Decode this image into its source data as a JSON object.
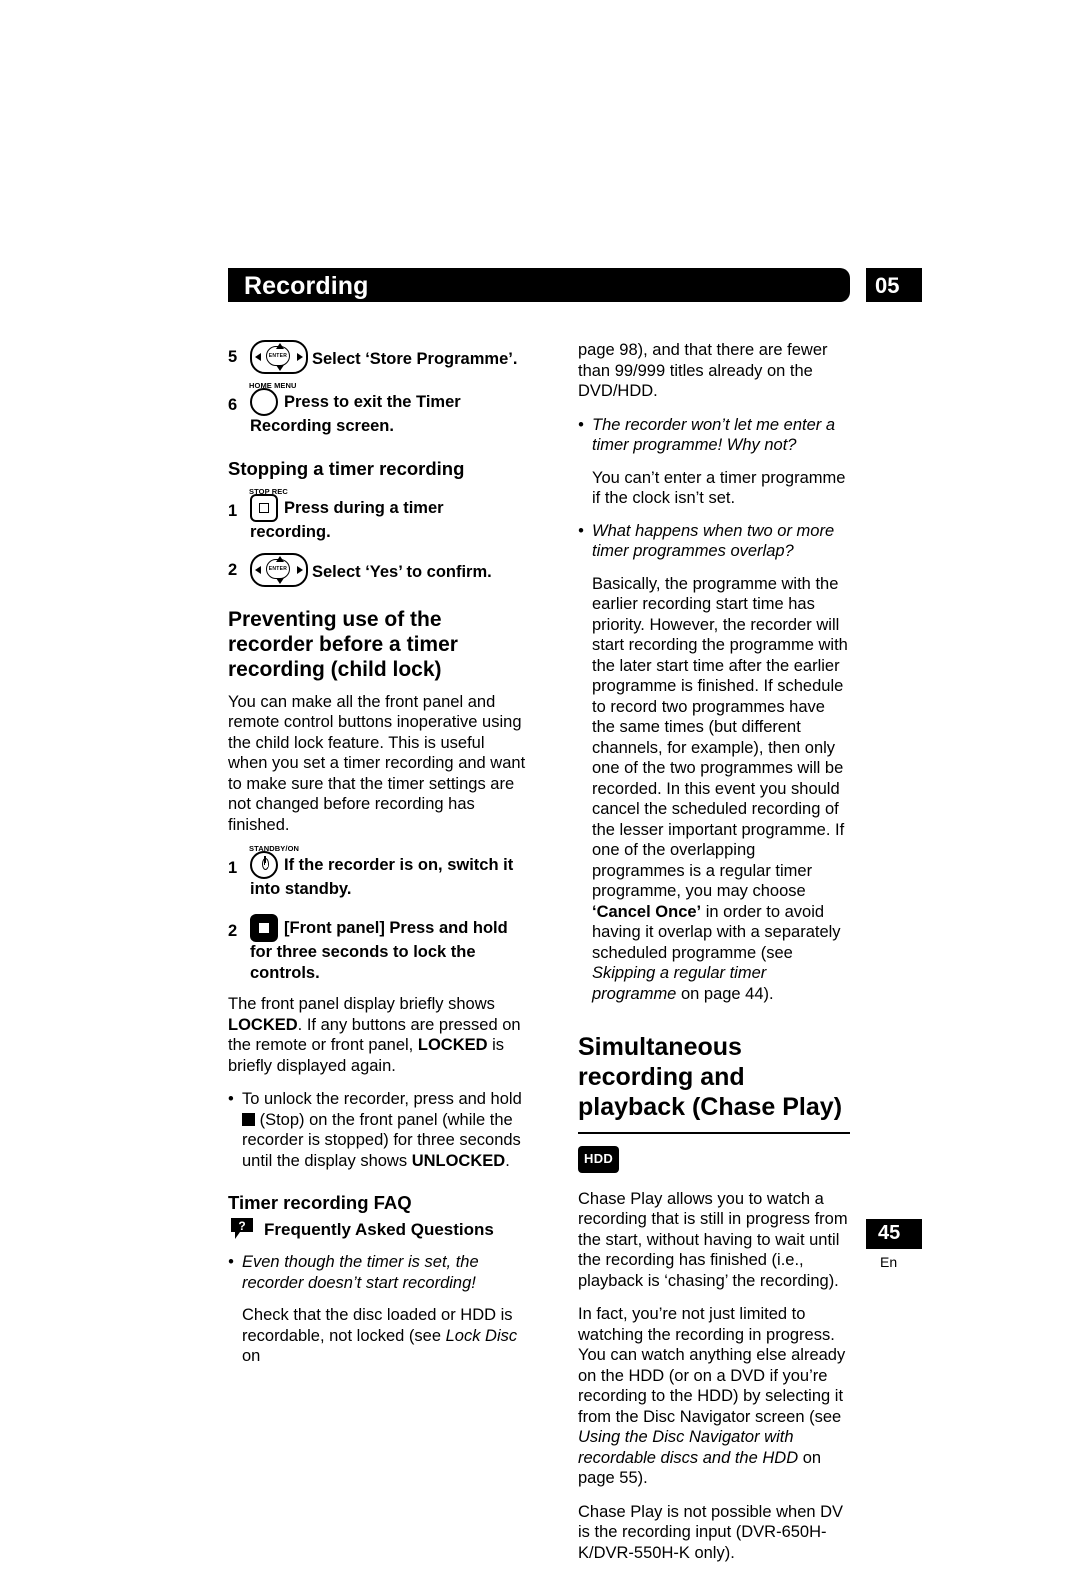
{
  "header": {
    "title": "Recording",
    "chapter": "05"
  },
  "footer": {
    "page_number": "45",
    "language": "En"
  },
  "left_column": {
    "step5": {
      "num": "5",
      "icon_label": "ENTER",
      "text": "Select ‘Store Programme’."
    },
    "step6": {
      "num": "6",
      "icon_label": "HOME MENU",
      "text": "Press to exit the Timer Recording screen."
    },
    "heading_stopping": "Stopping a timer recording",
    "stop_step1": {
      "num": "1",
      "icon_label": "STOP REC",
      "text": "Press during a timer recording."
    },
    "stop_step2": {
      "num": "2",
      "icon_label": "ENTER",
      "text": "Select ‘Yes’ to confirm."
    },
    "heading_preventing": "Preventing use of the recorder before a timer recording (child lock)",
    "para_childlock": "You can make all the front panel and remote control buttons inoperative using the child lock feature. This is useful when you set a timer recording and want to make sure that the timer settings are not changed before recording has finished.",
    "lock_step1": {
      "num": "1",
      "icon_label": "STANDBY/ON",
      "text": "If the recorder is on, switch it into standby."
    },
    "lock_step2": {
      "num": "2",
      "text_bold_1": "[Front panel] Press and hold for three seconds to lock the controls."
    },
    "para_locked_1": "The front panel display briefly shows ",
    "locked_word": "LOCKED",
    "para_locked_2": ". If any buttons are pressed on the remote or front panel, ",
    "locked_word_2": "LOCKED",
    "para_locked_3": " is briefly displayed again.",
    "bullet_unlock_1": "To unlock the recorder, press and hold ",
    "bullet_unlock_2": " (Stop) on the front panel (while the recorder is stopped) for three seconds until the display shows ",
    "unlocked_word": "UNLOCKED",
    "bullet_unlock_3": ".",
    "heading_faq": "Timer recording FAQ",
    "faq_title": "Frequently Asked Questions",
    "faq_q1": "Even though the timer is set, the recorder doesn’t start recording!",
    "faq_a1_1": "Check that the disc loaded or HDD is recordable, not locked (see ",
    "faq_a1_italic": "Lock Disc",
    "faq_a1_2": " on"
  },
  "right_column": {
    "cont_1": "page 98), and that there are fewer than 99/999 titles already on the DVD/HDD.",
    "q2": "The recorder won’t let me enter a timer programme! Why not?",
    "a2": "You can’t enter a timer programme if the clock isn’t set.",
    "q3": "What happens when two or more timer programmes overlap?",
    "a3_part1": "Basically, the programme with the earlier recording start time has priority. However, the recorder will start recording the programme with the later start time after the earlier programme is finished. If schedule to record two programmes have the same times (but different channels, for example), then only one of the two programmes will be recorded. In this event you should cancel the scheduled recording of the lesser important programme. If one of the overlapping programmes is a regular timer programme, you may choose ",
    "cancel_once": "‘Cancel Once’",
    "a3_part2": " in order to avoid having it overlap with a separately scheduled programme (see ",
    "a3_italic": "Skipping a regular timer programme",
    "a3_part3": " on page 44).",
    "heading_chase": "Simultaneous recording and playback (Chase Play)",
    "hdd_badge": "HDD",
    "chase_p1": "Chase Play allows you to watch a recording that is still in progress from the start, without having to wait until the recording has finished (i.e., playback is ‘chasing’ the recording).",
    "chase_p2_1": "In fact, you’re not just limited to watching the recording in progress. You can watch anything else already on the HDD (or on a DVD if you’re recording to the HDD) by selecting it from the Disc Navigator screen (see ",
    "chase_p2_italic": "Using the Disc Navigator with recordable discs and the HDD",
    "chase_p2_2": " on page 55).",
    "chase_p3": "Chase Play is not possible when DV is the recording input (DVR-650H-K/DVR-550H-K only)."
  }
}
